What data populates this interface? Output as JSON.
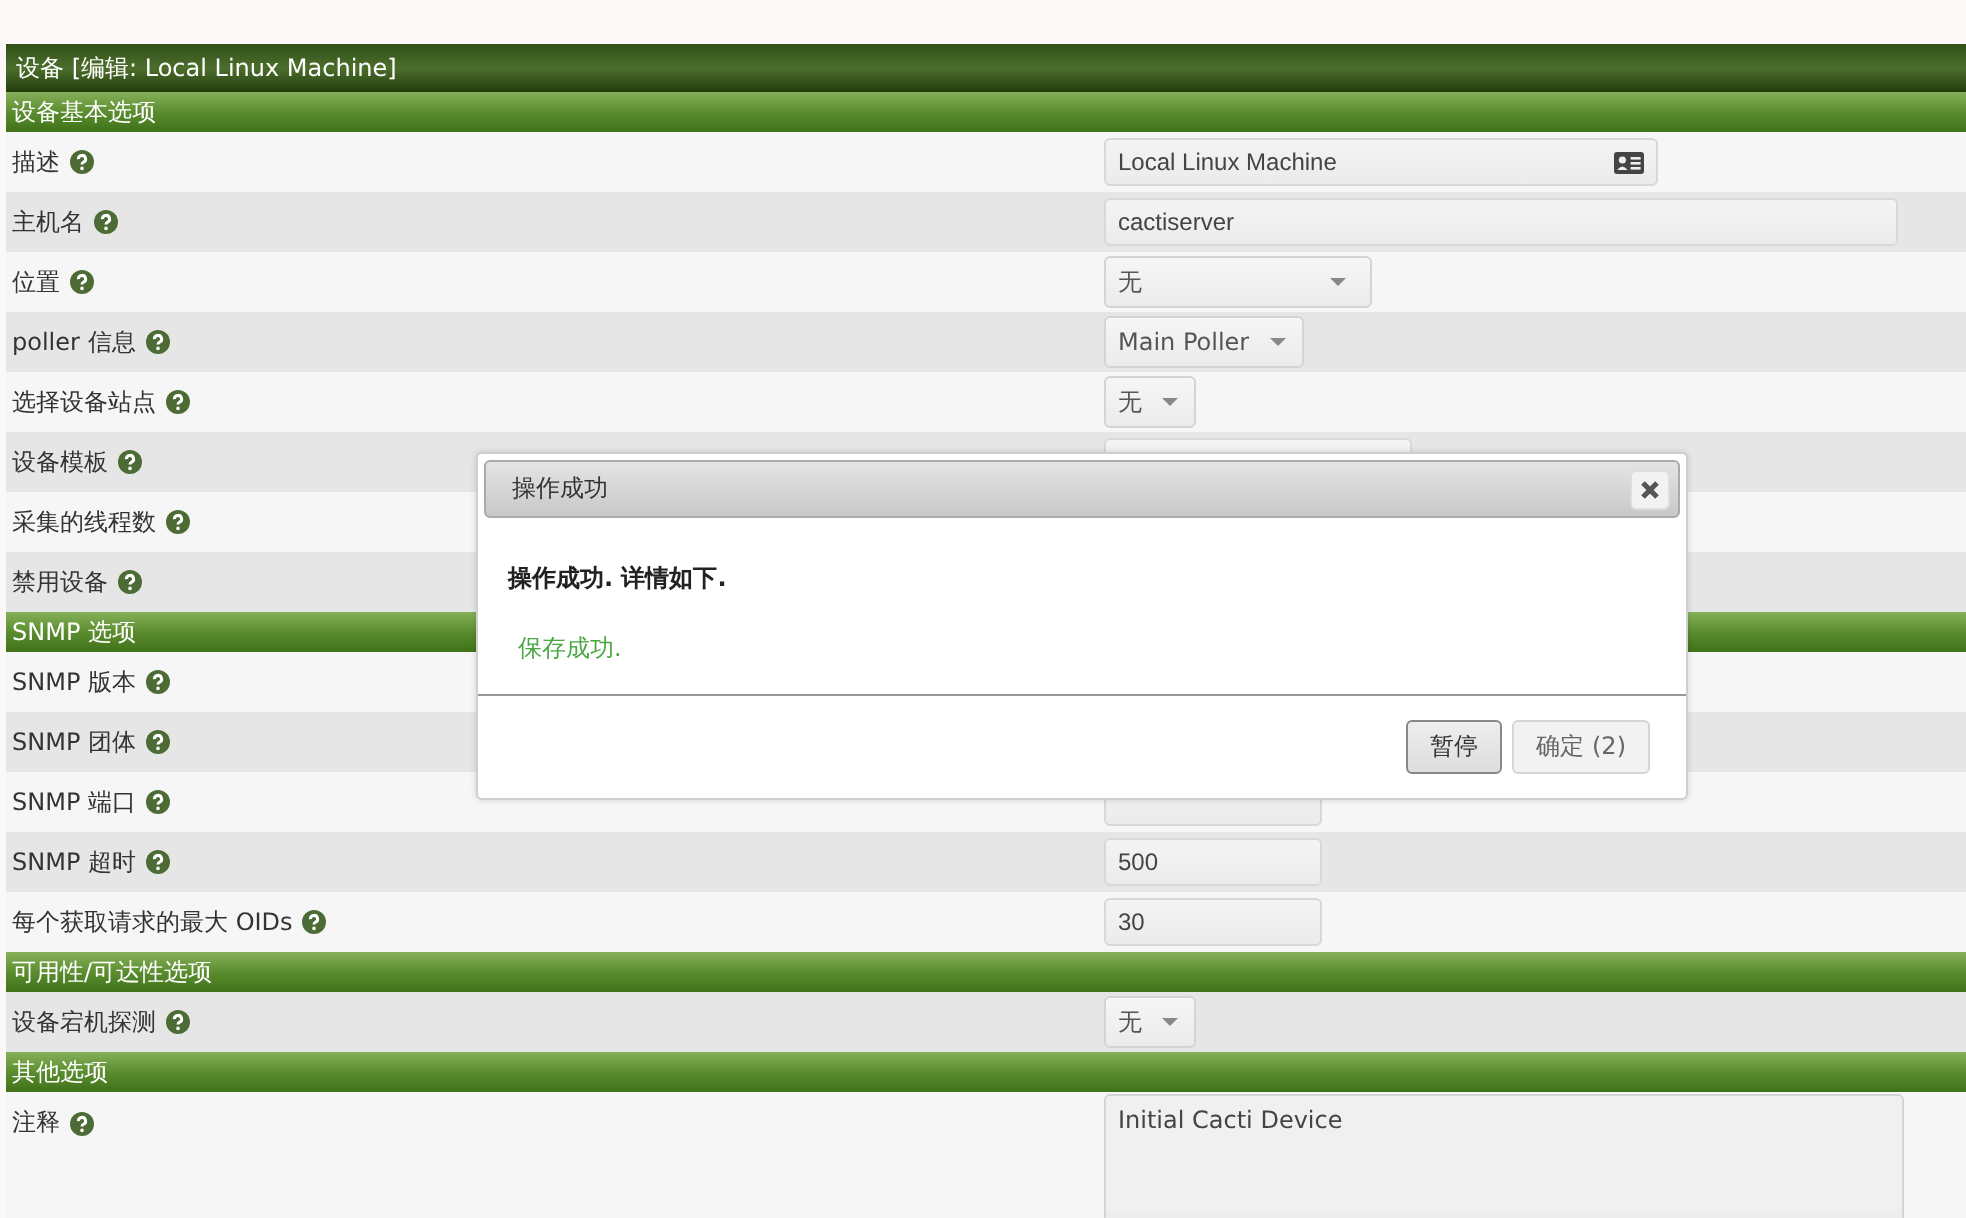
{
  "title": "设备 [编辑: Local Linux Machine]",
  "sections": [
    {
      "title": "设备基本选项",
      "rows": [
        {
          "label": "描述",
          "field": {
            "kind": "text",
            "value": "Local Linux Machine"
          }
        },
        {
          "label": "主机名",
          "field": {
            "kind": "text-long",
            "value": "cactiserver"
          }
        },
        {
          "label": "位置",
          "field": {
            "kind": "select-wide",
            "value": "无"
          }
        },
        {
          "label": "poller 信息",
          "field": {
            "kind": "select",
            "value": "Main Poller"
          }
        },
        {
          "label": "选择设备站点",
          "field": {
            "kind": "select",
            "value": "无"
          }
        },
        {
          "label": "设备模板",
          "field": {
            "kind": "hidden-wide"
          }
        },
        {
          "label": "采集的线程数"
        },
        {
          "label": "禁用设备"
        }
      ]
    },
    {
      "title": "SNMP 选项",
      "rows": [
        {
          "label": "SNMP 版本"
        },
        {
          "label": "SNMP 团体"
        },
        {
          "label": "SNMP 端口",
          "field": {
            "kind": "hidden-number"
          }
        },
        {
          "label": "SNMP 超时",
          "field": {
            "kind": "number",
            "value": "500"
          }
        },
        {
          "label": "每个获取请求的最大 OIDs",
          "field": {
            "kind": "number",
            "value": "30"
          }
        }
      ]
    },
    {
      "title": "可用性/可达性选项",
      "rows": [
        {
          "label": "设备宕机探测",
          "field": {
            "kind": "select",
            "value": "无"
          }
        }
      ]
    },
    {
      "title": "其他选项",
      "rows": [
        {
          "label": "注释",
          "field": {
            "kind": "textarea",
            "value": "Initial Cacti Device"
          }
        }
      ]
    }
  ],
  "dialog": {
    "title": "操作成功",
    "message": "操作成功. 详情如下.",
    "detail": "保存成功.",
    "buttons": [
      {
        "label": "暂停",
        "disabled": false
      },
      {
        "label": "确定 (2)",
        "disabled": true
      }
    ]
  }
}
